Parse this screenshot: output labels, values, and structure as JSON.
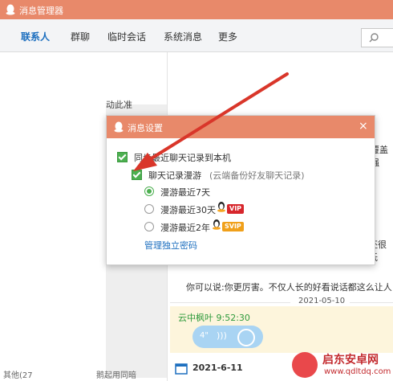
{
  "window": {
    "title": "消息管理器"
  },
  "tabs": [
    {
      "label": "联系人",
      "active": true
    },
    {
      "label": "群聊"
    },
    {
      "label": "临时会话"
    },
    {
      "label": "系统消息"
    },
    {
      "label": "更多"
    }
  ],
  "left": {
    "partial_label": "动此准",
    "bottom_left": "其他(27",
    "bottom_right": "鹅起用同暗"
  },
  "right": {
    "partial_text1": "覆盖强",
    "partial_text2": "还很低",
    "message": "你可以说:你更厉害。不仅人长的好看说话都这么让人",
    "date1": "2021-05-10",
    "sender": "云中枫叶  9:52:30",
    "voice_duration": "4\"",
    "date2": "2021-6-11"
  },
  "dialog": {
    "title": "消息设置",
    "close": "×",
    "sync_label": "同步最近聊天记录到本机",
    "roam_label": "聊天记录漫游",
    "roam_hint": "(云端备份好友聊天记录)",
    "options": [
      {
        "label": "漫游最近7天",
        "selected": true
      },
      {
        "label": "漫游最近30天",
        "badge": "VIP"
      },
      {
        "label": "漫游最近2年",
        "badge": "SVIP"
      }
    ],
    "manage_link": "管理独立密码"
  },
  "watermark": {
    "name": "启东安卓网",
    "url": "www.qdltdq.com"
  },
  "colors": {
    "accent": "#e8896a",
    "link": "#1d6fbf",
    "check": "#4caf50",
    "arrow": "#d9362a"
  }
}
